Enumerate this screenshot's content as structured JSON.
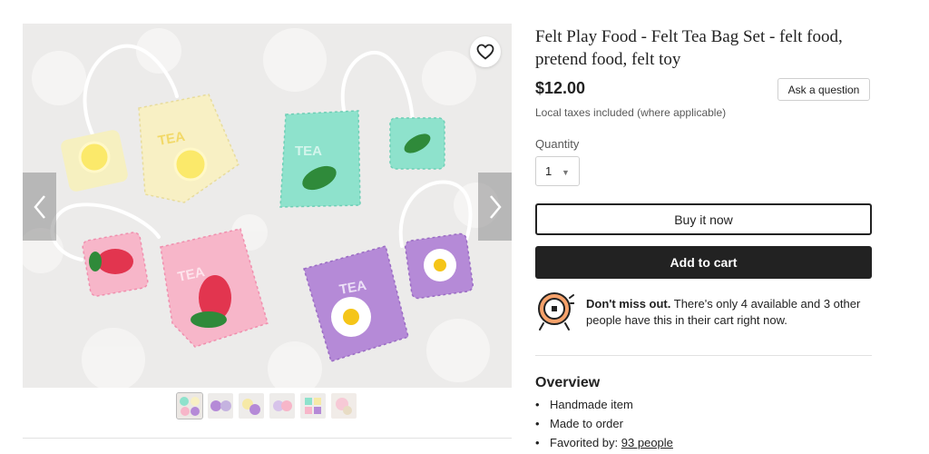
{
  "listing": {
    "title": "Felt Play Food - Felt Tea Bag Set - felt food, pretend food, felt toy",
    "price": "$12.00",
    "ask_label": "Ask a question",
    "taxes_note": "Local taxes included (where applicable)"
  },
  "quantity": {
    "label": "Quantity",
    "value": "1",
    "caret": "▼"
  },
  "actions": {
    "buy_now": "Buy it now",
    "add_to_cart": "Add to cart"
  },
  "notice": {
    "bold": "Don't miss out.",
    "text": " There's only 4 available and 3 other people have this in their cart right now."
  },
  "overview": {
    "title": "Overview",
    "items": [
      "Handmade item",
      "Made to order"
    ],
    "favorited_prefix": "Favorited by: ",
    "favorited_link": "93 people",
    "bullet": "•"
  },
  "photo": {
    "tea_label": "TEA",
    "background_color": "#ecebea",
    "bags": [
      "yellow-lemon",
      "mint-leaf",
      "pink-strawberry",
      "purple-daisy"
    ]
  },
  "gallery": {
    "thumbnails": 6,
    "active_thumbnail": 1
  },
  "icons": {
    "favorite": "heart-icon",
    "prev": "chevron-left-icon",
    "next": "chevron-right-icon",
    "alarm": "alarm-clock-icon"
  }
}
